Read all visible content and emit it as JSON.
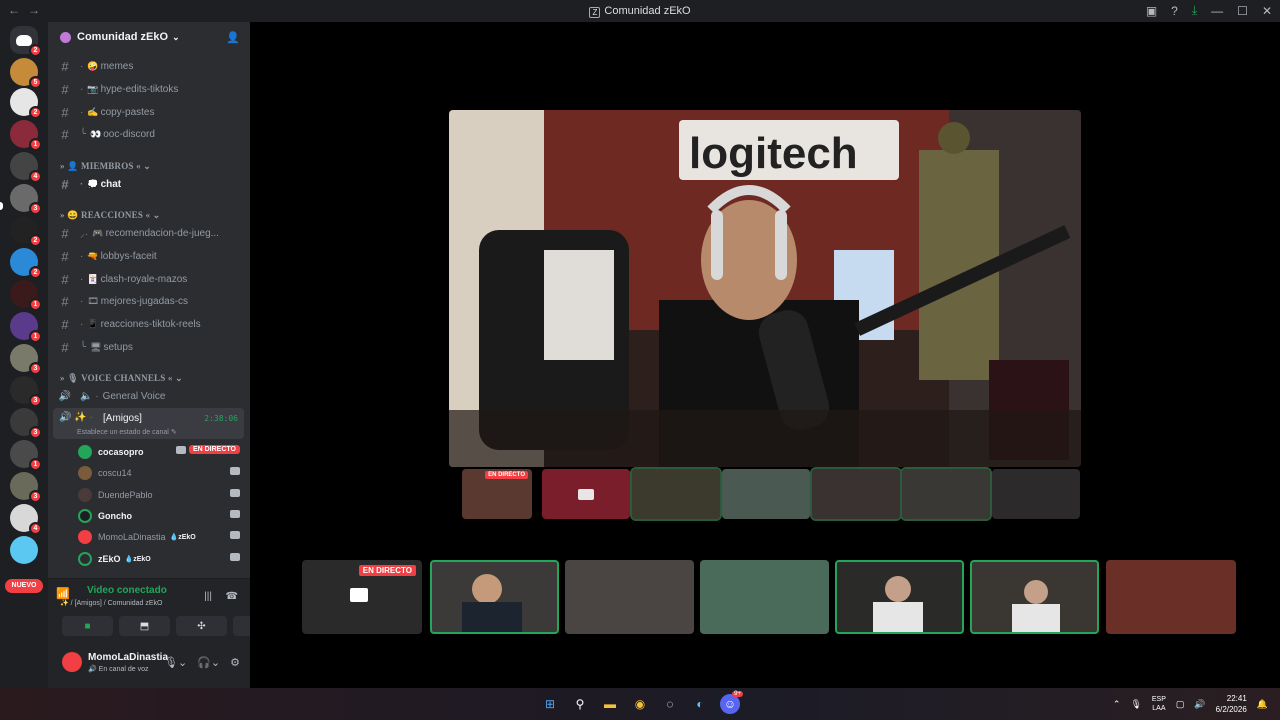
{
  "window": {
    "title": "Comunidad zEkO",
    "nav_back": "←",
    "nav_fwd": "→"
  },
  "server": {
    "name": "Comunidad zEkO"
  },
  "guild_badges": [
    "2",
    "5",
    "2",
    "1",
    "4",
    "3",
    "2",
    "2",
    "1",
    "1",
    "3",
    "3",
    "3",
    "1",
    "3",
    "4"
  ],
  "guild_new_label": "NUEVO",
  "channels": [
    {
      "label": "memes",
      "emoji": "🤪"
    },
    {
      "label": "hype-edits-tiktoks",
      "emoji": "📷"
    },
    {
      "label": "copy-pastes",
      "emoji": "✍"
    },
    {
      "label": "ooc-discord",
      "emoji": "👀"
    }
  ],
  "categories": {
    "miembros": "MIEMBROS",
    "reacciones": "REACCIONES",
    "voice": "VOICE CHANNELS"
  },
  "chat_channel": {
    "label": "chat",
    "emoji": "💭"
  },
  "reacciones_channels": [
    {
      "label": "recomendacion-de-jueg...",
      "emoji": "🎮"
    },
    {
      "label": "lobbys-faceit",
      "emoji": "🔫"
    },
    {
      "label": "clash-royale-mazos",
      "emoji": "🃏"
    },
    {
      "label": "mejores-jugadas-cs",
      "emoji": "🎞"
    },
    {
      "label": "reacciones-tiktok-reels",
      "emoji": "📱"
    },
    {
      "label": "setups",
      "emoji": "🖥"
    }
  ],
  "voice_channels": {
    "general": "General Voice",
    "amigos": "[Amigos]",
    "amigos_time": "2:38:06",
    "amigos_status": "Establece un estado de canal"
  },
  "voice_users": [
    {
      "name": "cocasopro",
      "live": "EN DIRECTO",
      "bright": true,
      "color": "#23a55a"
    },
    {
      "name": "coscu14",
      "bright": false,
      "color": "#7a5c3c"
    },
    {
      "name": "DuendePablo",
      "bright": false,
      "color": "#4a3a3a"
    },
    {
      "name": "Goncho",
      "bright": true,
      "color": "#23a55a"
    },
    {
      "name": "MomoLaDinastia",
      "tag": "💧zEkO",
      "bright": false,
      "color": "#f23f43"
    },
    {
      "name": "zEkO",
      "tag": "💧zEkO",
      "bright": true,
      "color": "#2b2d31"
    }
  ],
  "voice_panel": {
    "connected": "Video conectado",
    "location": "[Amigos] / Comunidad zEkO"
  },
  "user": {
    "name": "MomoLaDinastia",
    "status": "En canal de voz"
  },
  "stream": {
    "live_label": "EN DIRECTO",
    "bottom_live_label": "EN DIRECTO"
  },
  "taskbar": {
    "lang_top": "ESP",
    "lang_bottom": "LAA",
    "time": "22:41",
    "date": "6/2/2026",
    "discord_badge": "9+"
  }
}
